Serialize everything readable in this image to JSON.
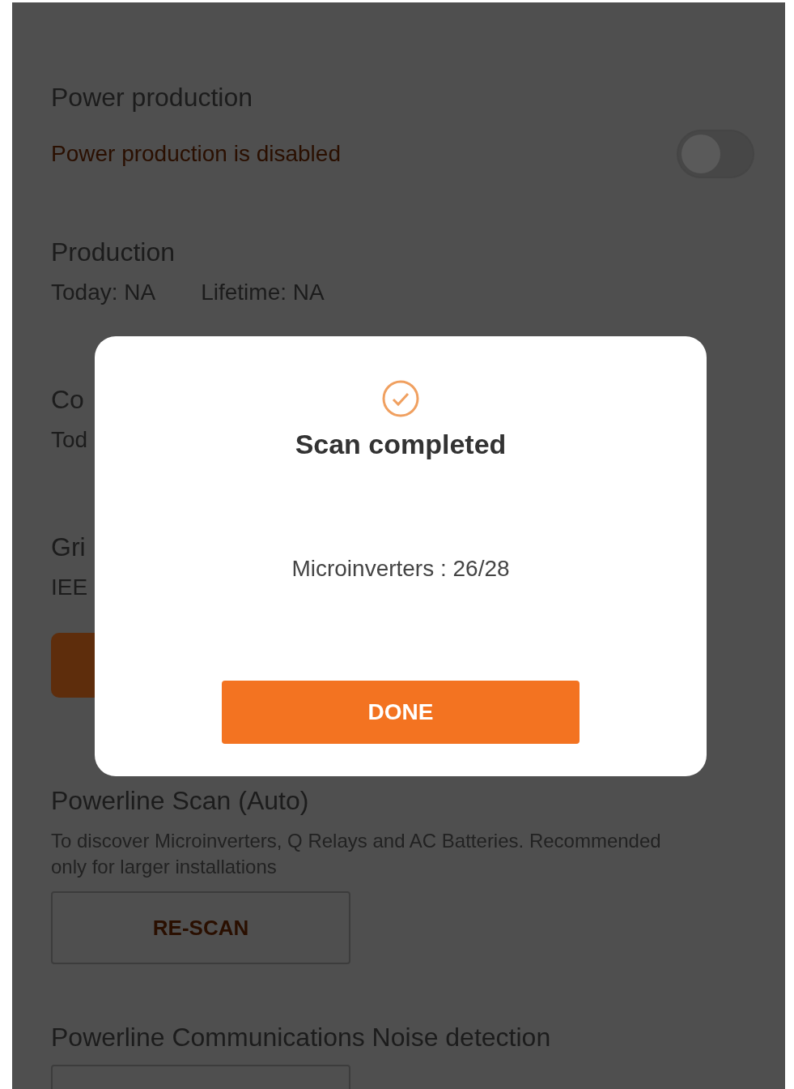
{
  "sections": [
    {
      "kind": "toggle",
      "title": "Power production",
      "status": "Power production is disabled",
      "on": false
    },
    {
      "kind": "stats",
      "title": "Production",
      "values": [
        "Today: NA",
        "Lifetime: NA"
      ]
    },
    {
      "kind": "stats",
      "title": "Co",
      "values": [
        "Tod"
      ]
    },
    {
      "kind": "stats",
      "title": "Gri",
      "values": [
        "IEE"
      ]
    },
    {
      "kind": "filled_button"
    },
    {
      "kind": "scan",
      "title": "Powerline Scan (Auto)",
      "description": "To discover Microinverters, Q Relays and AC Batteries. Recommended only for larger installations",
      "button": "RE-SCAN"
    },
    {
      "kind": "scan",
      "title": "Powerline Communications Noise detection"
    }
  ],
  "dialog": {
    "title": "Scan completed",
    "message": "Microinverters : 26/28",
    "button": "DONE"
  }
}
